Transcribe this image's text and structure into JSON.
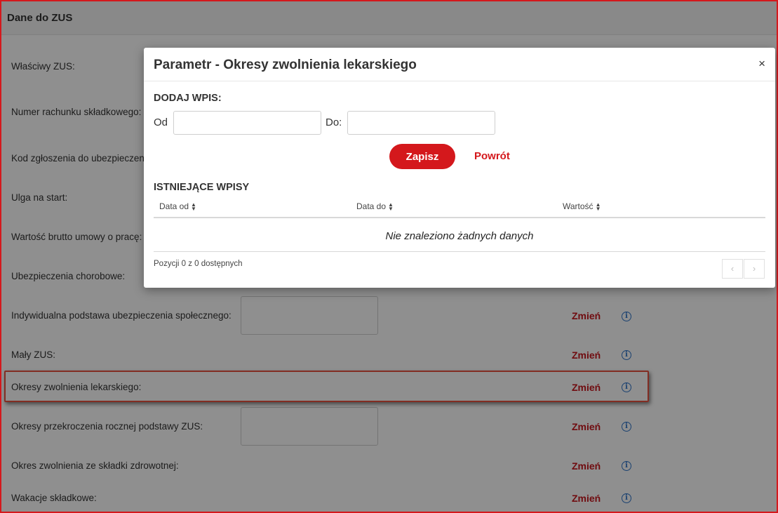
{
  "section": {
    "title": "Dane do ZUS"
  },
  "rows": [
    {
      "label": "Właściwy ZUS:"
    },
    {
      "label": "Numer rachunku składkowego:"
    },
    {
      "label": "Kod zgłoszenia do ubezpieczeni"
    },
    {
      "label": "Ulga na start:"
    },
    {
      "label": "Wartość brutto umowy o pracę:"
    },
    {
      "label": "Ubezpieczenia chorobowe:"
    },
    {
      "label": "Indywidualna podstawa ubezpieczenia społecznego:",
      "change": "Zmień"
    },
    {
      "label": "Mały ZUS:",
      "change": "Zmień"
    },
    {
      "label": "Okresy zwolnienia lekarskiego:",
      "change": "Zmień"
    },
    {
      "label": "Okresy przekroczenia rocznej podstawy ZUS:",
      "change": "Zmień"
    },
    {
      "label": "Okres zwolnienia ze składki zdrowotnej:",
      "change": "Zmień"
    },
    {
      "label": "Wakacje składkowe:",
      "change": "Zmień"
    }
  ],
  "icons": {
    "info": "info-icon",
    "close": "close-icon",
    "sort": "sort-icon",
    "prev": "chevron-left-icon",
    "next": "chevron-right-icon"
  },
  "colors": {
    "accent": "#d4181c",
    "info": "#2f74c8",
    "highlight": "#e8503f"
  },
  "modal": {
    "title": "Parametr - Okresy zwolnienia lekarskiego",
    "close": "×",
    "add_heading": "DODAJ WPIS:",
    "from_label": "Od",
    "to_label": "Do:",
    "from_value": "",
    "to_value": "",
    "save_label": "Zapisz",
    "back_label": "Powrót",
    "existing_heading": "ISTNIEJĄCE WPISY",
    "columns": [
      "Data od",
      "Data do",
      "Wartość"
    ],
    "empty_text": "Nie znaleziono żadnych danych",
    "info_text": "Pozycji 0 z 0 dostępnych",
    "pager_prev": "‹",
    "pager_next": "›"
  }
}
